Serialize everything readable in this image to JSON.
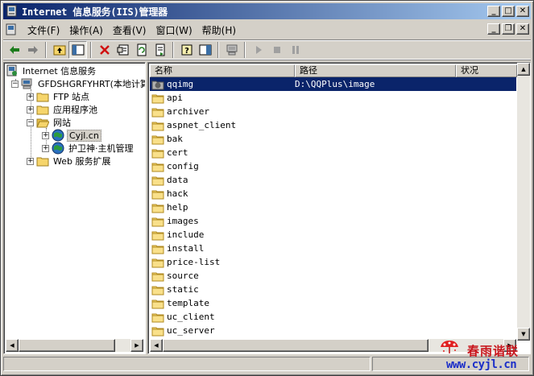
{
  "window": {
    "title": "Internet 信息服务(IIS)管理器"
  },
  "menu": {
    "file": "文件(F)",
    "action": "操作(A)",
    "view": "查看(V)",
    "window": "窗口(W)",
    "help": "帮助(H)"
  },
  "tree": {
    "root": "Internet 信息服务",
    "computer": "GFDSHGRFYHRT(本地计算机)",
    "ftp": "FTP 站点",
    "app_pools": "应用程序池",
    "websites": "网站",
    "site1": "Cyjl.cn",
    "site2": "护卫神·主机管理",
    "web_ext": "Web 服务扩展"
  },
  "list": {
    "columns": [
      "名称",
      "路径",
      "状况"
    ],
    "rows": [
      {
        "name": "qqimg",
        "path": "D:\\QQPlus\\image"
      },
      {
        "name": "api",
        "path": ""
      },
      {
        "name": "archiver",
        "path": ""
      },
      {
        "name": "aspnet_client",
        "path": ""
      },
      {
        "name": "bak",
        "path": ""
      },
      {
        "name": "cert",
        "path": ""
      },
      {
        "name": "config",
        "path": ""
      },
      {
        "name": "data",
        "path": ""
      },
      {
        "name": "hack",
        "path": ""
      },
      {
        "name": "help",
        "path": ""
      },
      {
        "name": "images",
        "path": ""
      },
      {
        "name": "include",
        "path": ""
      },
      {
        "name": "install",
        "path": ""
      },
      {
        "name": "price-list",
        "path": ""
      },
      {
        "name": "source",
        "path": ""
      },
      {
        "name": "static",
        "path": ""
      },
      {
        "name": "template",
        "path": ""
      },
      {
        "name": "uc_client",
        "path": ""
      },
      {
        "name": "uc_server",
        "path": ""
      }
    ]
  },
  "watermark": {
    "brand": "春雨谐联",
    "url": "www.cyjl.cn"
  },
  "colors": {
    "title_start": "#0a246a",
    "title_end": "#a6caf0",
    "selection": "#0a246a",
    "face": "#d4d0c8",
    "folder": "#f6d56b"
  }
}
